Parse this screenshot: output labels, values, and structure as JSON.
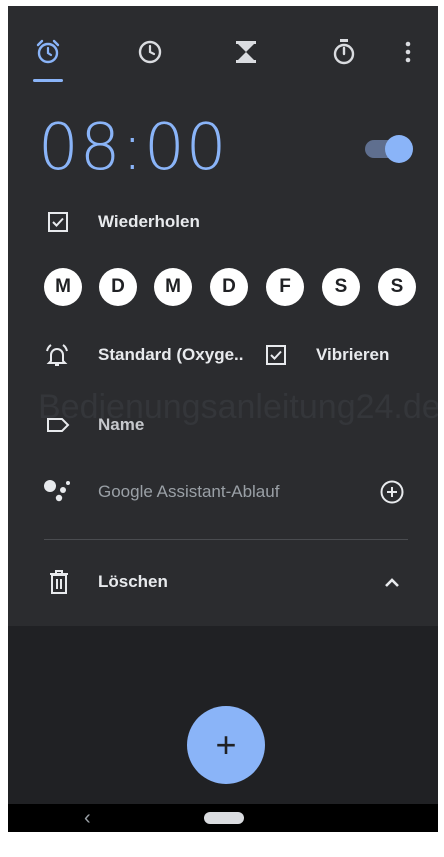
{
  "nav": {
    "tabs": [
      {
        "icon": "alarm-icon",
        "active": true
      },
      {
        "icon": "clock-icon",
        "active": false
      },
      {
        "icon": "timer-hourglass-icon",
        "active": false
      },
      {
        "icon": "stopwatch-icon",
        "active": false
      }
    ],
    "menu_icon": "more-vert-icon"
  },
  "alarm": {
    "time": "08:00",
    "enabled": true,
    "repeat_label": "Wiederholen",
    "repeat_checked": true,
    "days": [
      "M",
      "D",
      "M",
      "D",
      "F",
      "S",
      "S"
    ],
    "ringtone_label": "Standard (Oxyge..",
    "vibrate_label": "Vibrieren",
    "vibrate_checked": true,
    "name_label": "Name",
    "assistant_label": "Google Assistant-Ablauf",
    "delete_label": "Löschen"
  },
  "watermark": "Bedienungsanleitung24.de",
  "fab_label": "+",
  "system_nav": {
    "back_glyph": "‹"
  },
  "colors": {
    "accent": "#8ab4f8",
    "background": "#202124",
    "card": "#2b2c2f",
    "text": "#e8eaed",
    "muted": "#9aa0a6"
  }
}
